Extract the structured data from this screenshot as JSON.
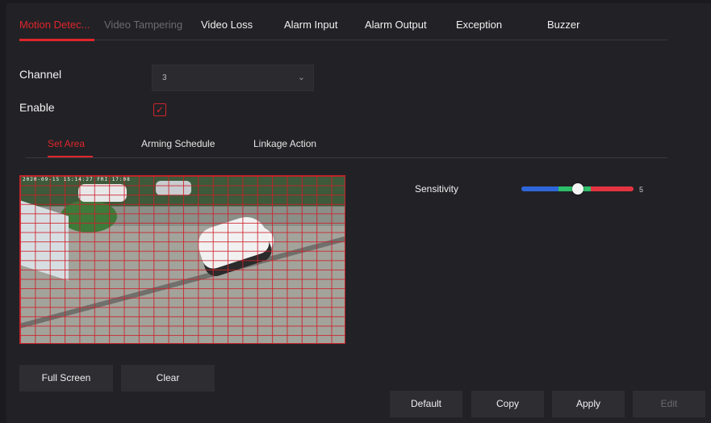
{
  "tabs": [
    {
      "label": "Motion Detec...",
      "state": "active"
    },
    {
      "label": "Video Tampering",
      "state": "disabled"
    },
    {
      "label": "Video Loss",
      "state": "normal"
    },
    {
      "label": "Alarm Input",
      "state": "normal"
    },
    {
      "label": "Alarm Output",
      "state": "normal"
    },
    {
      "label": "Exception",
      "state": "normal"
    },
    {
      "label": "Buzzer",
      "state": "normal"
    }
  ],
  "form": {
    "channel_label": "Channel",
    "channel_value": "3",
    "enable_label": "Enable",
    "enable_checked": true
  },
  "subtabs": [
    {
      "label": "Set Area",
      "state": "active"
    },
    {
      "label": "Arming Schedule",
      "state": "normal"
    },
    {
      "label": "Linkage Action",
      "state": "normal"
    }
  ],
  "video": {
    "osd_text": "2020-09-15 15:14:27 FRI 17:08"
  },
  "sensitivity": {
    "label": "Sensitivity",
    "value": "5",
    "level_fraction": 0.5
  },
  "area_buttons": {
    "full_screen": "Full Screen",
    "clear": "Clear"
  },
  "footer_buttons": {
    "default": "Default",
    "copy": "Copy",
    "apply": "Apply",
    "edit": "Edit"
  },
  "colors": {
    "accent": "#e0252b",
    "background": "#222226"
  }
}
